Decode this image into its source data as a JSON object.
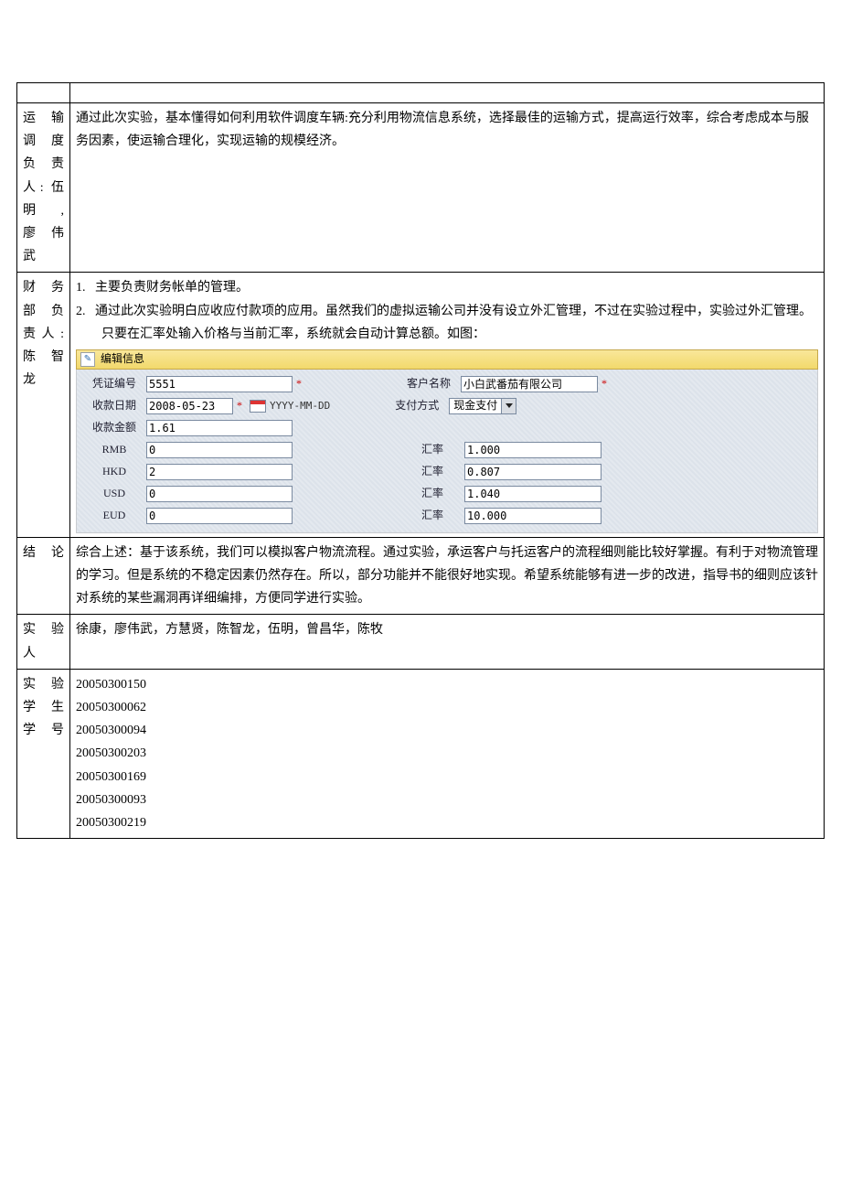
{
  "rows": {
    "row1": {
      "label_lines": [
        "运 输",
        "调 度",
        "负 责",
        "人: 伍",
        "明 ,",
        "廖 伟",
        "武"
      ],
      "content": "通过此次实验，基本懂得如何利用软件调度车辆:充分利用物流信息系统，选择最佳的运输方式，提高运行效率，综合考虑成本与服务因素，使运输合理化，实现运输的规模经济。"
    },
    "row2": {
      "label_lines": [
        "财 务",
        "部 负",
        "责人:",
        "陈 智",
        "龙"
      ],
      "list": [
        "主要负责财务帐单的管理。",
        "通过此次实验明白应收应付款项的应用。虽然我们的虚拟运输公司并没有设立外汇管理，不过在实验过程中，实验过外汇管理。只要在汇率处输入价格与当前汇率，系统就会自动计算总额。如图："
      ]
    },
    "row3": {
      "label": "结论",
      "content": "综合上述：基于该系统，我们可以模拟客户物流流程。通过实验，承运客户与托运客户的流程细则能比较好掌握。有利于对物流管理的学习。但是系统的不稳定因素仍然存在。所以，部分功能并不能很好地实现。希望系统能够有进一步的改进，指导书的细则应该针对系统的某些漏洞再详细编排，方便同学进行实验。"
    },
    "row4": {
      "label_lines": [
        "实 验",
        "人"
      ],
      "content": "徐康，廖伟武，方慧贤，陈智龙，伍明，曾昌华，陈牧"
    },
    "row5": {
      "label_lines": [
        "实 验",
        "学 生",
        "学号"
      ],
      "ids": [
        "20050300150",
        "20050300062",
        "20050300094",
        "20050300203",
        "20050300169",
        "20050300093",
        "20050300219"
      ]
    }
  },
  "form": {
    "title": "编辑信息",
    "labels": {
      "voucher_no": "凭证编号",
      "customer_name": "客户名称",
      "recv_date": "收款日期",
      "pay_method": "支付方式",
      "recv_amount": "收款金额",
      "rate": "汇率",
      "rmb": "RMB",
      "hkd": "HKD",
      "usd": "USD",
      "eud": "EUD",
      "date_hint": "YYYY-MM-DD"
    },
    "values": {
      "voucher_no": "5551",
      "customer_name": "小白武番茄有限公司",
      "recv_date": "2008-05-23",
      "pay_method": "现金支付",
      "recv_amount": "1.61",
      "rmb": "0",
      "rmb_rate": "1.000",
      "hkd": "2",
      "hkd_rate": "0.807",
      "usd": "0",
      "usd_rate": "1.040",
      "eud": "0",
      "eud_rate": "10.000"
    }
  }
}
